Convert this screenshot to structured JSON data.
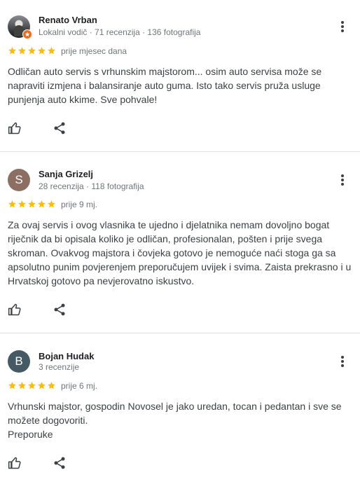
{
  "colors": {
    "star": "#fbbc04",
    "avatar_s": "#8d6e63",
    "avatar_b": "#455a64",
    "local_guide_badge": "#f26b1d"
  },
  "reviews": [
    {
      "name": "Renato Vrban",
      "meta": "Lokalni vodič · 71 recenzija · 136 fotografija",
      "avatar": {
        "type": "photo",
        "letter": ""
      },
      "rating": 5,
      "when": "prije mjesec dana",
      "text": "Odličan auto servis s vrhunskim majstorom... osim auto servisa može se napraviti izmjena i balansiranje auto guma. Isto tako servis pruža usluge punjenja auto kkime. Sve pohvale!"
    },
    {
      "name": "Sanja Grizelj",
      "meta": "28 recenzija · 118 fotografija",
      "avatar": {
        "type": "letter",
        "letter": "S"
      },
      "rating": 5,
      "when": "prije 9 mj.",
      "text": "Za ovaj servis i ovog vlasnika te ujedno i djelatnika nemam dovoljno bogat riječnik da bi opisala koliko je odličan, profesionalan, pošten i prije svega skroman. Ovakvog majstora i čovjeka gotovo je nemoguće naći stoga ga sa apsolutno punim povjerenjem preporučujem uvijek i svima. Zaista prekrasno i u Hrvatskoj gotovo pa nevjerovatno iskustvo."
    },
    {
      "name": "Bojan Hudak",
      "meta": "3 recenzije",
      "avatar": {
        "type": "letter",
        "letter": "B"
      },
      "rating": 5,
      "when": "prije 6 mj.",
      "text": "Vrhunski majstor, gospodin Novosel je jako uredan, tocan i pedantan i sve se možete dogovoriti.",
      "extra": "Preporuke"
    }
  ]
}
